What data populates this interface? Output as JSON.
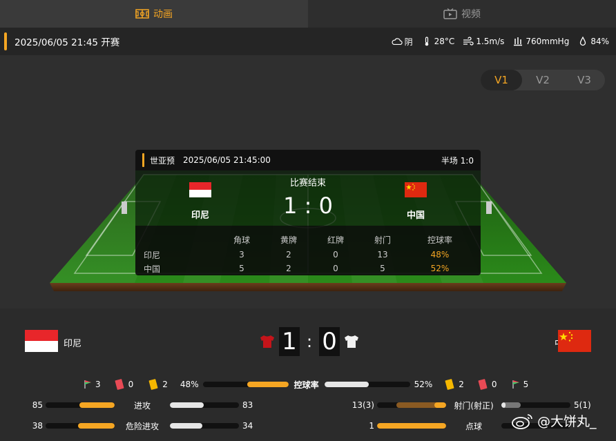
{
  "tabs": [
    {
      "label": "动画",
      "icon": "pitch-icon"
    },
    {
      "label": "视频",
      "icon": "tv-icon"
    }
  ],
  "info": {
    "datetime": "2025/06/05 21:45 开赛",
    "weather": "阴",
    "temp": "28°C",
    "wind": "1.5m/s",
    "pressure": "760mmHg",
    "humidity": "84%"
  },
  "versions": [
    "V1",
    "V2",
    "V3"
  ],
  "board": {
    "league": "世亚预",
    "datetime": "2025/06/05 21:45:00",
    "halftime": "半场 1:0",
    "status": "比赛结束",
    "score": "1 : 0",
    "home": "印尼",
    "away": "中国",
    "headers": [
      "角球",
      "黄牌",
      "红牌",
      "射门",
      "控球率"
    ],
    "rows": [
      {
        "team": "印尼",
        "values": [
          "3",
          "2",
          "0",
          "13",
          "48%"
        ]
      },
      {
        "team": "中国",
        "values": [
          "5",
          "2",
          "0",
          "5",
          "52%"
        ]
      }
    ]
  },
  "match": {
    "home": "印尼",
    "away": "中国",
    "home_score": "1",
    "away_score": "0",
    "colon": ":"
  },
  "summary": {
    "home_corners": "3",
    "home_red": "0",
    "home_yellow": "2",
    "away_yellow": "2",
    "away_red": "0",
    "away_corners": "5",
    "possession_label": "控球率",
    "home_possession": "48%",
    "away_possession": "52%",
    "home_possession_value": 0.48,
    "away_possession_value": 0.52
  },
  "stats_left": [
    {
      "label": "进攻",
      "home": "85",
      "away": "83",
      "home_frac": 0.506,
      "away_frac": 0.494
    },
    {
      "label": "危险进攻",
      "home": "38",
      "away": "34",
      "home_frac": 0.528,
      "away_frac": 0.472
    }
  ],
  "stats_right": [
    {
      "label": "射门(射正)",
      "home": "13(3)",
      "away": "5(1)",
      "home_frac": 0.72,
      "home_on_frac": 0.17,
      "away_frac": 0.28,
      "away_on_frac": 0.06
    },
    {
      "label": "点球",
      "home": "1",
      "away": "",
      "home_frac": 1.0,
      "away_frac": 0.0
    }
  ],
  "watermark": "@大饼丸_",
  "colors": {
    "accent": "#f5a623",
    "home_red": "#e8262a",
    "china_red": "#de2910",
    "yellow_card": "#f5b700",
    "red_card": "#e84a55"
  }
}
